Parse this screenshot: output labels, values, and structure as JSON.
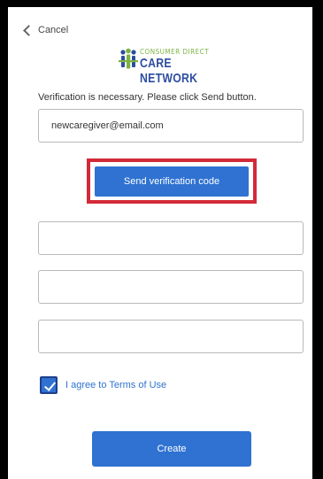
{
  "header": {
    "cancel_label": "Cancel"
  },
  "logo": {
    "line1": "CONSUMER DIRECT",
    "line2": "CARE NETWORK"
  },
  "form": {
    "intro_text": "Verification is necessary. Please click Send button.",
    "email_value": "newcaregiver@email.com",
    "send_button_label": "Send verification code",
    "field1_value": "",
    "field2_value": "",
    "field3_value": "",
    "terms_checked": true,
    "terms_label": "I agree to Terms of Use",
    "create_button_label": "Create"
  },
  "colors": {
    "accent": "#2f72d1",
    "highlight": "#d32a37",
    "logo_green": "#7cb342",
    "logo_blue": "#2d4da0"
  }
}
